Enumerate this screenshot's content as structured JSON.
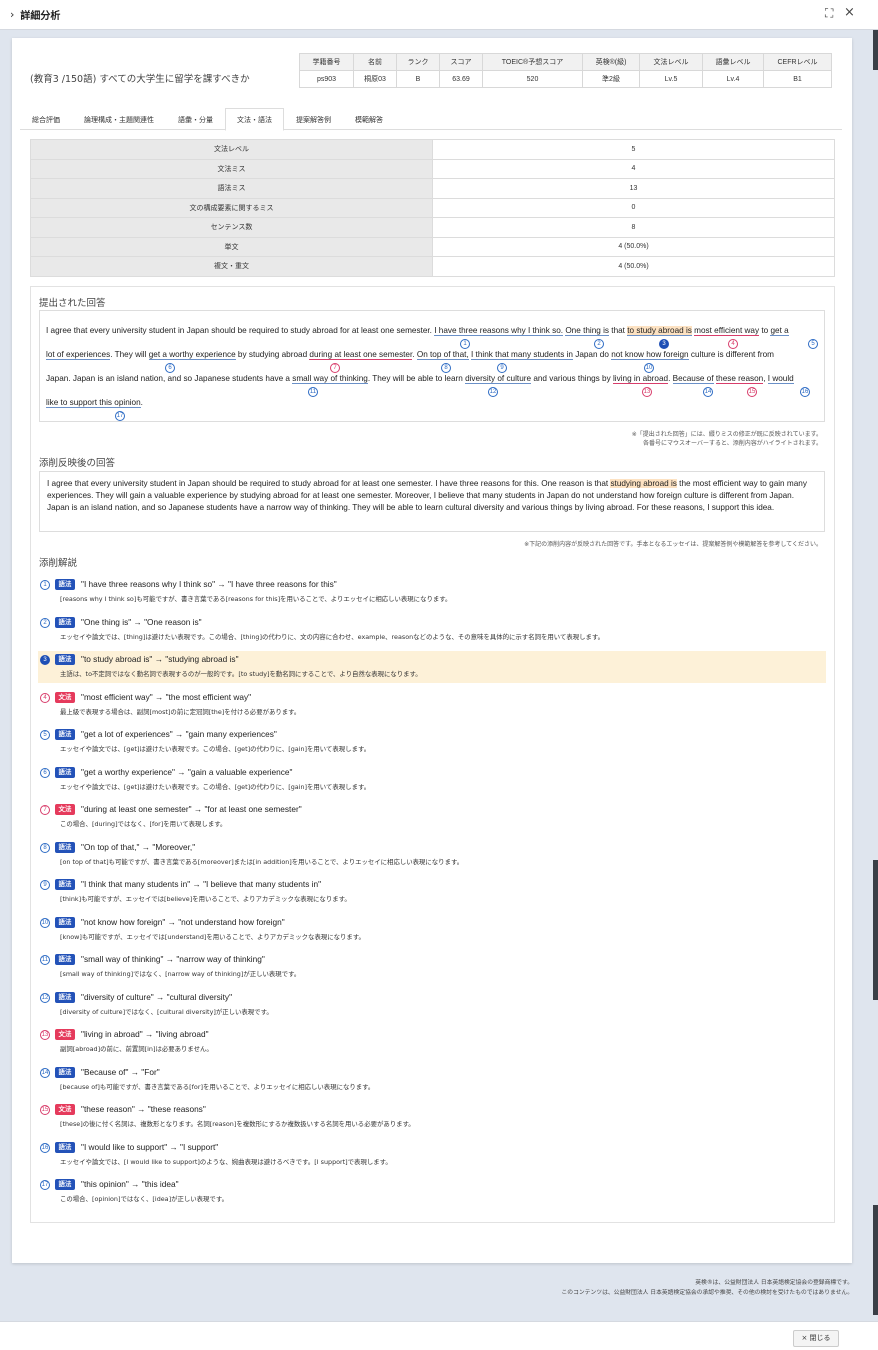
{
  "window": {
    "title": "詳細分析",
    "chevron": "›",
    "expand_icon": "⛶",
    "close_icon": "×"
  },
  "question": "(教育3 /150語) すべての大学生に留学を課すべきか",
  "info": {
    "headers": [
      "学籍番号",
      "名前",
      "ランク",
      "スコア",
      "TOEIC®予想スコア",
      "英検®(級)",
      "文法レベル",
      "語彙レベル",
      "CEFRレベル"
    ],
    "values": [
      "ps903",
      "桐原03",
      "B",
      "63.69",
      "520",
      "準2級",
      "Lv.5",
      "Lv.4",
      "B1"
    ]
  },
  "tabs": [
    "総合評価",
    "論理構成・主題関連性",
    "語彙・分量",
    "文法・語法",
    "提案解答例",
    "模範解答"
  ],
  "stats": [
    [
      "文法レベル",
      "5"
    ],
    [
      "文法ミス",
      "4"
    ],
    [
      "語法ミス",
      "13"
    ],
    [
      "文の構成要素に関するミス",
      "0"
    ],
    [
      "センテンス数",
      "8"
    ],
    [
      "単文",
      "4 (50.0%)"
    ],
    [
      "複文・重文",
      "4 (50.0%)"
    ]
  ],
  "submitted": {
    "heading": "提出された回答",
    "l1": [
      "I agree that every university student in Japan should be required to study abroad for at least one semester. ",
      "I have three reasons why I think so.",
      " ",
      "One thing is",
      " that ",
      "to study abroad is",
      " ",
      "most efficient way",
      " to ",
      "get a"
    ],
    "l2": [
      "lot of experiences",
      ". They will ",
      "get a worthy experience",
      " by studying abroad ",
      "during at least one semester",
      ". ",
      "On top of that,",
      " ",
      "I think that many students in",
      " Japan do ",
      "not know how foreign",
      " culture is different from"
    ],
    "l3": [
      "Japan. Japan is an island nation, and so Japanese students have a ",
      "small way of thinking",
      ". They will be able to learn ",
      "diversity of culture",
      " and various things by ",
      "living in abroad",
      ". ",
      "Because of",
      " ",
      "these reason",
      ", ",
      "I would"
    ],
    "l4": [
      "like to support this opinion",
      "."
    ],
    "nums": [
      "1",
      "2",
      "3",
      "4",
      "5",
      "6",
      "7",
      "8",
      "9",
      "10",
      "11",
      "12",
      "13",
      "14",
      "15",
      "16",
      "17"
    ],
    "note1": "※「提出された回答」には、綴りミスの修正が既に反映されています。",
    "note2": "各番号にマウスオーバーすると、添削内容がハイライトされます。"
  },
  "revised": {
    "heading": "添削反映後の回答",
    "pre": "I agree that every university student in Japan should be required to study abroad for at least one semester. I have three reasons for this. One reason is that ",
    "hl": "studying abroad is",
    "post": " the most efficient way to gain many experiences. They will gain a valuable experience by studying abroad for at least one semester. Moreover, I believe that many students in Japan do not understand how foreign culture is different from Japan. Japan is an island nation, and so Japanese students have a narrow way of thinking. They will be able to learn cultural diversity and various things by living abroad. For these reasons, I support this idea.",
    "note": "※下記の添削内容が反映された回答です。手本となるエッセイは、提案解答例や模範解答を参考してください。"
  },
  "commentary": {
    "heading": "添削解説",
    "items": [
      {
        "n": "1",
        "type": "語法",
        "t": "\"I have three reasons why I think so\" → \"I have three reasons for this\"",
        "ex": "[reasons why I think so]も可能ですが、書き言葉である[reasons for this]を用いることで、よりエッセイに相応しい表現になります。"
      },
      {
        "n": "2",
        "type": "語法",
        "t": "\"One thing is\" → \"One reason is\"",
        "ex": "エッセイや論文では、[thing]は避けたい表現です。この場合、[thing]の代わりに、文の内容に合わせ、example、reasonなどのような、その意味を具体的に示す名詞を用いて表現します。"
      },
      {
        "n": "3",
        "type": "語法",
        "t": "\"to study abroad is\" → \"studying abroad is\"",
        "ex": "主語は、to不定詞ではなく動名詞で表現するのが一般的です。[to study]を動名詞にすることで、より自然な表現になります。"
      },
      {
        "n": "4",
        "type": "文法",
        "t": "\"most efficient way\" → \"the most efficient way\"",
        "ex": "最上級で表現する場合は、副詞[most]の前に定冠詞[the]を付ける必要があります。"
      },
      {
        "n": "5",
        "type": "語法",
        "t": "\"get a lot of experiences\" → \"gain many experiences\"",
        "ex": "エッセイや論文では、[get]は避けたい表現です。この場合、[get]の代わりに、[gain]を用いて表現します。"
      },
      {
        "n": "6",
        "type": "語法",
        "t": "\"get a worthy experience\" → \"gain a valuable experience\"",
        "ex": "エッセイや論文では、[get]は避けたい表現です。この場合、[get]の代わりに、[gain]を用いて表現します。"
      },
      {
        "n": "7",
        "type": "文法",
        "t": "\"during at least one semester\" → \"for at least one semester\"",
        "ex": "この場合、[during]ではなく、[for]を用いて表現します。"
      },
      {
        "n": "8",
        "type": "語法",
        "t": "\"On top of that,\" → \"Moreover,\"",
        "ex": "[on top of that]も可能ですが、書き言葉である[moreover]または[in addition]を用いることで、よりエッセイに相応しい表現になります。"
      },
      {
        "n": "9",
        "type": "語法",
        "t": "\"I think that many students in\" → \"I believe that many students in\"",
        "ex": "[think]も可能ですが、エッセイでは[believe]を用いることで、よりアカデミックな表現になります。"
      },
      {
        "n": "10",
        "type": "語法",
        "t": "\"not know how foreign\" → \"not understand how foreign\"",
        "ex": "[know]も可能ですが、エッセイでは[understand]を用いることで、よりアカデミックな表現になります。"
      },
      {
        "n": "11",
        "type": "語法",
        "t": "\"small way of thinking\" → \"narrow way of thinking\"",
        "ex": "[small way of thinking]ではなく、[narrow way of thinking]が正しい表現です。"
      },
      {
        "n": "12",
        "type": "語法",
        "t": "\"diversity of culture\" → \"cultural diversity\"",
        "ex": "[diversity of culture]ではなく、[cultural diversity]が正しい表現です。"
      },
      {
        "n": "13",
        "type": "文法",
        "t": "\"living in abroad\" → \"living abroad\"",
        "ex": "副詞[abroad]の前に、前置詞[in]は必要ありません。"
      },
      {
        "n": "14",
        "type": "語法",
        "t": "\"Because of\" → \"For\"",
        "ex": "[because of]も可能ですが、書き言葉である[for]を用いることで、よりエッセイに相応しい表現になります。"
      },
      {
        "n": "15",
        "type": "文法",
        "t": "\"these reason\" → \"these reasons\"",
        "ex": "[these]の後に付く名詞は、複数形となります。名詞[reason]を複数形にするか複数扱いする名詞を用いる必要があります。"
      },
      {
        "n": "16",
        "type": "語法",
        "t": "\"I would like to support\" → \"I support\"",
        "ex": "エッセイや論文では、[I would like to support]のような、婉曲表現は避けるべきです。[I support]で表現します。"
      },
      {
        "n": "17",
        "type": "語法",
        "t": "\"this opinion\" → \"this idea\"",
        "ex": "この場合、[opinion]ではなく、[idea]が正しい表現です。"
      }
    ]
  },
  "footer": {
    "l1": "英検®は、公益財団法人 日本英語検定協会の登録商標です。",
    "l2": "このコンテンツは、公益財団法人 日本英語検定協会の承認や推奨、その他の検討を受けたものではありません。"
  },
  "close_label": "× 閉じる"
}
